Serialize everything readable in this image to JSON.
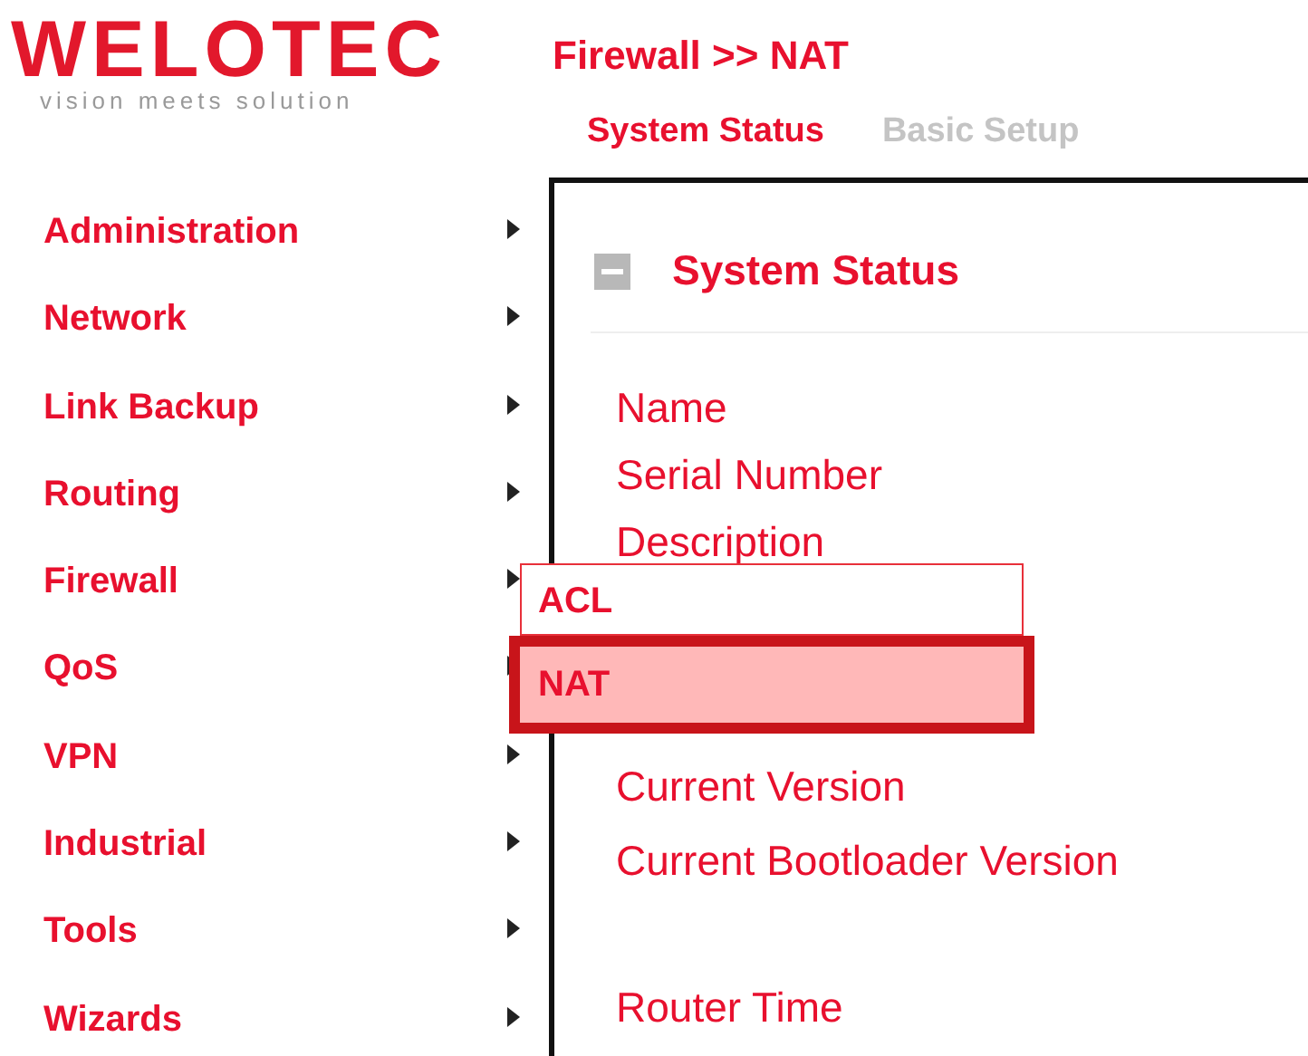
{
  "logo": {
    "wordmark": "WELOTEC",
    "tagline": "vision meets solution"
  },
  "breadcrumb": "Firewall >> NAT",
  "tabs": [
    {
      "label": "System Status",
      "selected": true
    },
    {
      "label": "Basic Setup",
      "selected": false
    }
  ],
  "sidebar": {
    "items": [
      {
        "label": "Administration"
      },
      {
        "label": "Network"
      },
      {
        "label": "Link Backup"
      },
      {
        "label": "Routing"
      },
      {
        "label": "Firewall"
      },
      {
        "label": "QoS"
      },
      {
        "label": "VPN"
      },
      {
        "label": "Industrial"
      },
      {
        "label": "Tools"
      },
      {
        "label": "Wizards"
      }
    ]
  },
  "submenu": [
    {
      "label": "ACL",
      "selected": false
    },
    {
      "label": "NAT",
      "selected": true
    }
  ],
  "panel": {
    "title": "System Status",
    "expanded": true,
    "field_groups": [
      [
        "Name",
        "Serial Number",
        "Description"
      ],
      [
        "Current Version",
        "Current Bootloader Version"
      ],
      [
        "Router Time"
      ]
    ]
  }
}
